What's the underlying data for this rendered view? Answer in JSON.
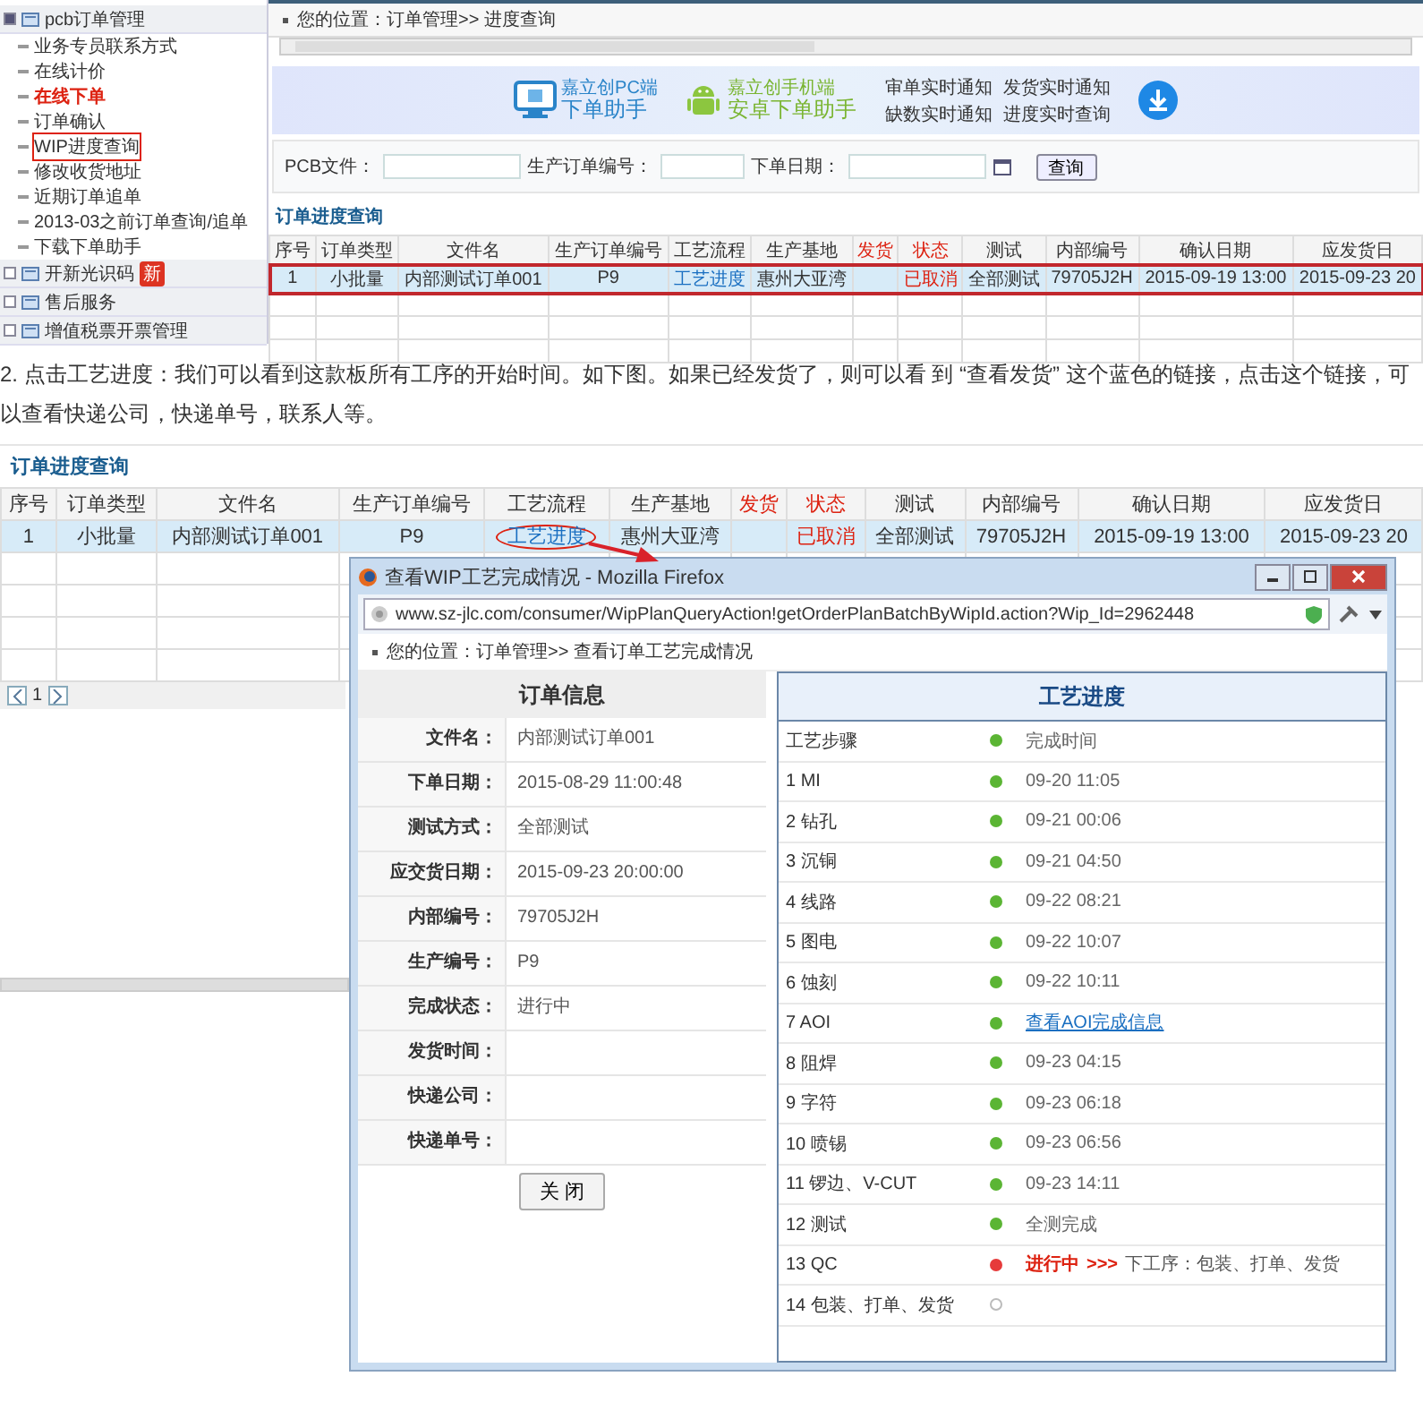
{
  "sidebar": {
    "groups": [
      {
        "label": "pcb订单管理",
        "expanded": true,
        "children": [
          {
            "label": "业务专员联系方式",
            "emphasized": false,
            "highlighted": false
          },
          {
            "label": "在线计价",
            "emphasized": false,
            "highlighted": false
          },
          {
            "label": "在线下单",
            "emphasized": true,
            "highlighted": false
          },
          {
            "label": "订单确认",
            "emphasized": false,
            "highlighted": false
          },
          {
            "label": "WIP进度查询",
            "emphasized": false,
            "highlighted": true
          },
          {
            "label": "修改收货地址",
            "emphasized": false,
            "highlighted": false
          },
          {
            "label": "近期订单追单",
            "emphasized": false,
            "highlighted": false
          },
          {
            "label": "2013-03之前订单查询/追单",
            "emphasized": false,
            "highlighted": false
          },
          {
            "label": "下载下单助手",
            "emphasized": false,
            "highlighted": false
          }
        ]
      },
      {
        "label": "开新光识码",
        "badge": "新",
        "expanded": false
      },
      {
        "label": "售后服务",
        "expanded": false
      },
      {
        "label": "增值税票开票管理",
        "expanded": false
      }
    ]
  },
  "top": {
    "breadcrumb": "您的位置：订单管理>> 进度查询",
    "banner": {
      "pc": [
        "嘉立创PC端",
        "下单助手"
      ],
      "mobile": [
        "嘉立创手机端",
        "安卓下单助手"
      ],
      "features": [
        "审单实时通知",
        "发货实时通知",
        "缺数实时通知",
        "进度实时查询"
      ]
    },
    "search": {
      "fields": [
        "PCB文件：",
        "生产订单编号：",
        "下单日期："
      ],
      "button": "查询"
    },
    "title": "订单进度查询",
    "table": {
      "columns": [
        {
          "label": "序号",
          "emphasized": false
        },
        {
          "label": "订单类型",
          "emphasized": false
        },
        {
          "label": "文件名",
          "emphasized": false
        },
        {
          "label": "生产订单编号",
          "emphasized": false
        },
        {
          "label": "工艺流程",
          "emphasized": false
        },
        {
          "label": "生产基地",
          "emphasized": false
        },
        {
          "label": "发货",
          "emphasized": true
        },
        {
          "label": "状态",
          "emphasized": true
        },
        {
          "label": "测试",
          "emphasized": false
        },
        {
          "label": "内部编号",
          "emphasized": false
        },
        {
          "label": "确认日期",
          "emphasized": false
        },
        {
          "label": "应发货日",
          "emphasized": false
        }
      ],
      "rows": [
        {
          "highlighted": true,
          "cells": [
            {
              "text": "1",
              "kind": "text"
            },
            {
              "text": "小批量",
              "kind": "text"
            },
            {
              "text": "内部测试订单001",
              "kind": "text"
            },
            {
              "text": "P9",
              "kind": "text"
            },
            {
              "text": "工艺进度",
              "kind": "link"
            },
            {
              "text": "惠州大亚湾",
              "kind": "text"
            },
            {
              "kind": "empty"
            },
            {
              "text": "已取消",
              "kind": "alert"
            },
            {
              "text": "全部测试",
              "kind": "text"
            },
            {
              "text": "79705J2H",
              "kind": "text"
            },
            {
              "text": "2015-09-19 13:00",
              "kind": "text"
            },
            {
              "text": "2015-09-23 20",
              "kind": "text"
            }
          ]
        }
      ]
    }
  },
  "paragraph": "2. 点击工艺进度：我们可以看到这款板所有工序的开始时间。如下图。如果已经发货了，则可以看 到 “查看发货” 这个蓝色的链接，点击这个链接，可以查看快递公司，快递单号，联系人等。",
  "main": {
    "title": "订单进度查询",
    "table": {
      "columns": [
        {
          "label": "序号",
          "emphasized": false
        },
        {
          "label": "订单类型",
          "emphasized": false
        },
        {
          "label": "文件名",
          "emphasized": false
        },
        {
          "label": "生产订单编号",
          "emphasized": false
        },
        {
          "label": "工艺流程",
          "emphasized": false
        },
        {
          "label": "生产基地",
          "emphasized": false
        },
        {
          "label": "发货",
          "emphasized": true
        },
        {
          "label": "状态",
          "emphasized": true
        },
        {
          "label": "测试",
          "emphasized": false
        },
        {
          "label": "内部编号",
          "emphasized": false
        },
        {
          "label": "确认日期",
          "emphasized": false
        },
        {
          "label": "应发货日",
          "emphasized": false
        }
      ],
      "rows": [
        {
          "highlighted": false,
          "cells": [
            {
              "text": "1",
              "kind": "text"
            },
            {
              "text": "小批量",
              "kind": "text"
            },
            {
              "text": "内部测试订单001",
              "kind": "text"
            },
            {
              "text": "P9",
              "kind": "text"
            },
            {
              "text": "工艺进度",
              "kind": "link",
              "circled": true
            },
            {
              "text": "惠州大亚湾",
              "kind": "text"
            },
            {
              "kind": "empty"
            },
            {
              "text": "已取消",
              "kind": "alert"
            },
            {
              "text": "全部测试",
              "kind": "text"
            },
            {
              "text": "79705J2H",
              "kind": "text"
            },
            {
              "text": "2015-09-19 13:00",
              "kind": "text"
            },
            {
              "text": "2015-09-23 20",
              "kind": "text"
            }
          ]
        }
      ]
    },
    "page": "1"
  },
  "popup": {
    "title": "查看WIP工艺完成情况 - Mozilla Firefox",
    "url": "www.sz-jlc.com/consumer/WipPlanQueryAction!getOrderPlanBatchByWipId.action?Wip_Id=2962448",
    "breadcrumb": "您的位置：订单管理>> 查看订单工艺完成情况",
    "info": {
      "title": "订单信息",
      "fields": [
        {
          "label": "文件名：",
          "value": "内部测试订单001"
        },
        {
          "label": "下单日期：",
          "value": "2015-08-29 11:00:48"
        },
        {
          "label": "测试方式：",
          "value": "全部测试"
        },
        {
          "label": "应交货日期：",
          "value": "2015-09-23 20:00:00"
        },
        {
          "label": "内部编号：",
          "value": "79705J2H"
        },
        {
          "label": "生产编号：",
          "value": "P9"
        },
        {
          "label": "完成状态：",
          "value": "进行中"
        },
        {
          "label": "发货时间："
        },
        {
          "label": "快递公司："
        },
        {
          "label": "快递单号："
        }
      ],
      "button": "关 闭"
    },
    "progress": {
      "title": "工艺进度",
      "steps": [
        {
          "step": "工艺步骤",
          "kind": "done",
          "time": "完成时间"
        },
        {
          "step": "1 MI",
          "kind": "done",
          "time": "09-20 11:05"
        },
        {
          "step": "2 钻孔",
          "kind": "done",
          "time": "09-21 00:06"
        },
        {
          "step": "3 沉铜",
          "kind": "done",
          "time": "09-21 04:50"
        },
        {
          "step": "4 线路",
          "kind": "done",
          "time": "09-22 08:21"
        },
        {
          "step": "5 图电",
          "kind": "done",
          "time": "09-22 10:07"
        },
        {
          "step": "6 蚀刻",
          "kind": "done",
          "time": "09-22 10:11"
        },
        {
          "step": "7 AOI",
          "kind": "done",
          "link": "查看AOI完成信息"
        },
        {
          "step": "8 阻焊",
          "kind": "done",
          "time": "09-23 04:15"
        },
        {
          "step": "9 字符",
          "kind": "done",
          "time": "09-23 06:18"
        },
        {
          "step": "10 喷锡",
          "kind": "done",
          "time": "09-23 06:56"
        },
        {
          "step": "11 锣边、V-CUT",
          "kind": "done",
          "time": "09-23 14:11"
        },
        {
          "step": "12 测试",
          "kind": "done",
          "time": "全测完成"
        },
        {
          "step": "13 QC",
          "kind": "current",
          "state_text": "进行中",
          "arrow": ">>>",
          "next": "下工序：包装、打单、发货"
        },
        {
          "step": "14 包装、打单、发货",
          "kind": "pending"
        }
      ]
    }
  }
}
